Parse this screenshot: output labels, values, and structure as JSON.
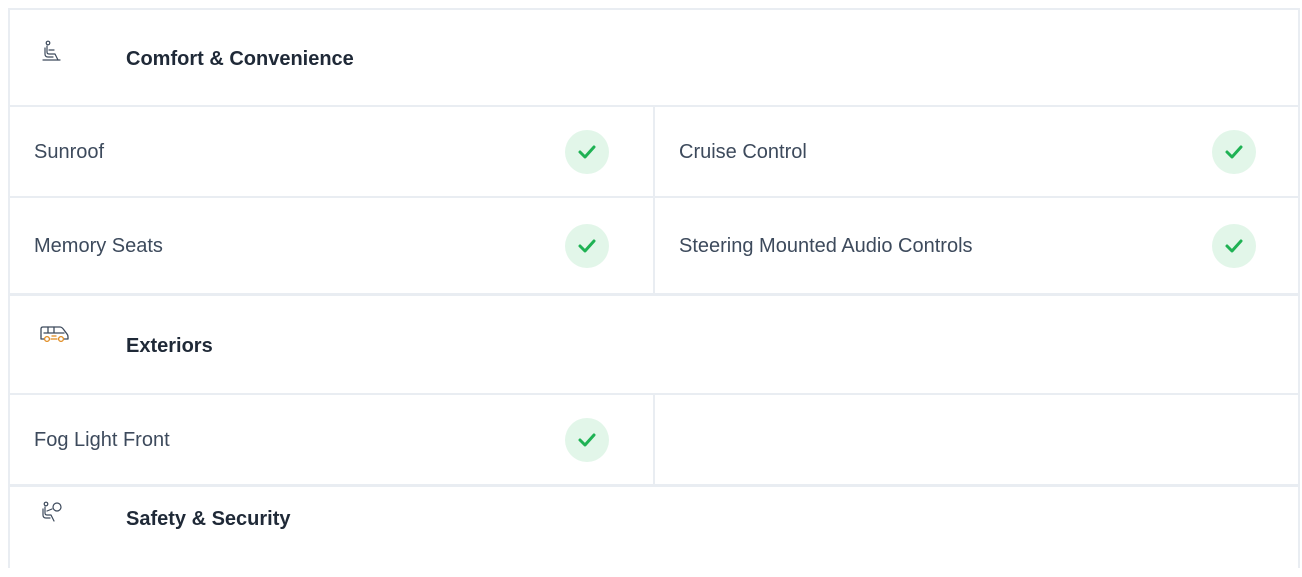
{
  "sections": [
    {
      "icon": "seat-icon",
      "title": "Comfort & Convenience",
      "rows": [
        [
          {
            "label": "Sunroof",
            "available": true
          },
          {
            "label": "Cruise Control",
            "available": true
          }
        ],
        [
          {
            "label": "Memory Seats",
            "available": true
          },
          {
            "label": "Steering Mounted Audio Controls",
            "available": true
          }
        ]
      ]
    },
    {
      "icon": "car-exterior-icon",
      "title": "Exteriors",
      "rows": [
        [
          {
            "label": "Fog Light Front",
            "available": true
          },
          null
        ]
      ]
    },
    {
      "icon": "airbag-icon",
      "title": "Safety & Security",
      "rows": []
    }
  ],
  "colors": {
    "check_green": "#1fb254",
    "check_bg": "#e2f6e9",
    "border": "#e9edf2",
    "icon_orange": "#e08a1e"
  }
}
